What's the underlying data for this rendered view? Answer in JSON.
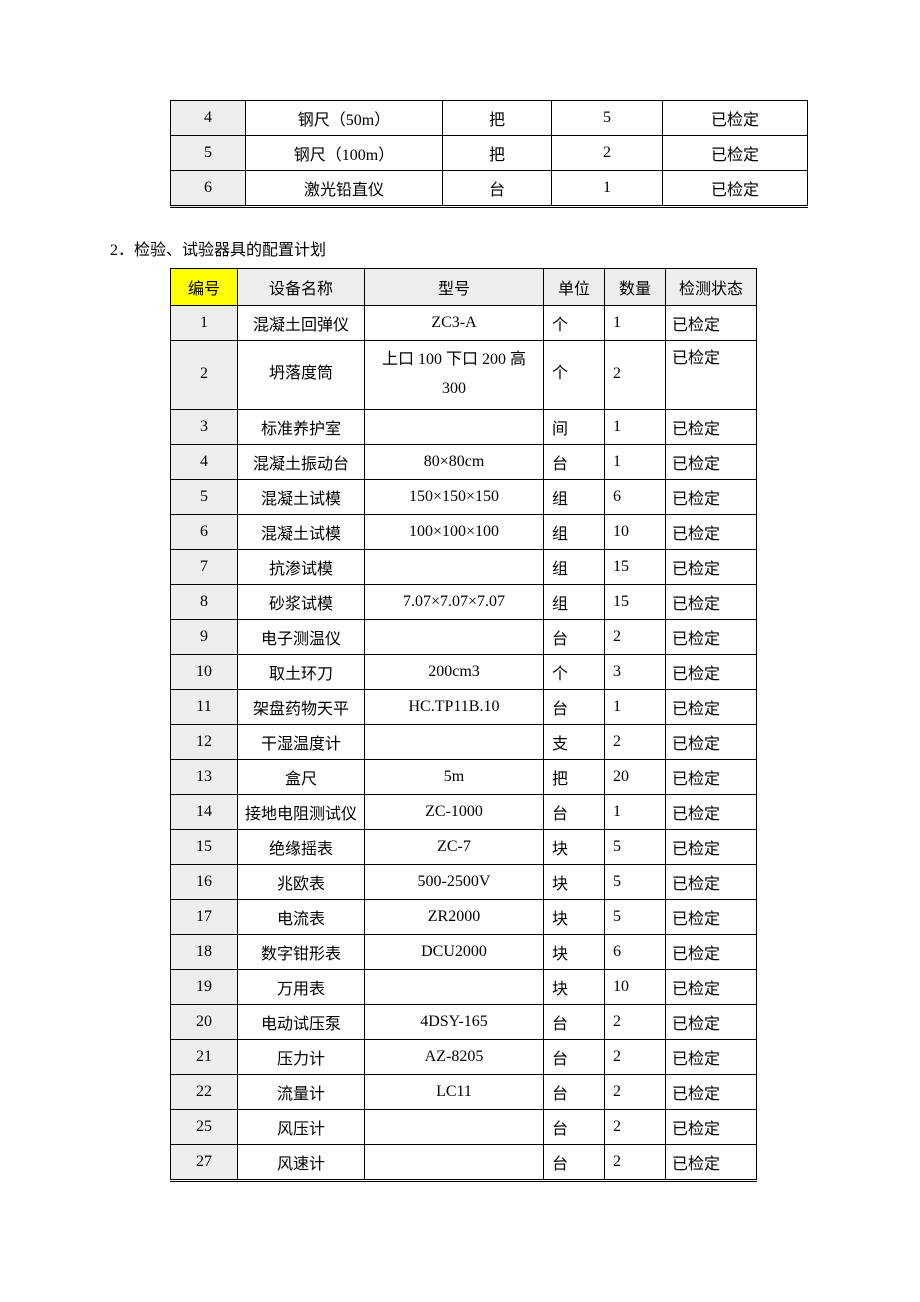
{
  "table1": {
    "rows": [
      {
        "num": "4",
        "name": "钢尺（50m）",
        "unit": "把",
        "qty": "5",
        "status": "已检定"
      },
      {
        "num": "5",
        "name": "钢尺（100m）",
        "unit": "把",
        "qty": "2",
        "status": "已检定"
      },
      {
        "num": "6",
        "name": "激光铅直仪",
        "unit": "台",
        "qty": "1",
        "status": "已检定"
      }
    ]
  },
  "section2_heading": "2．检验、试验器具的配置计划",
  "table2": {
    "headers": {
      "num": "编号",
      "name": "设备名称",
      "model": "型号",
      "unit": "单位",
      "qty": "数量",
      "status": "检测状态"
    },
    "rows": [
      {
        "num": "1",
        "name": "混凝土回弹仪",
        "model": "ZC3-A",
        "unit": "个",
        "qty": "1",
        "status": "已检定"
      },
      {
        "num": "2",
        "name": "坍落度筒",
        "model": "上口 100 下口 200 高300",
        "unit": "个",
        "qty": "2",
        "status": "已检定"
      },
      {
        "num": "3",
        "name": "标准养护室",
        "model": "",
        "unit": "间",
        "qty": "1",
        "status": "已检定"
      },
      {
        "num": "4",
        "name": "混凝土振动台",
        "model": "80×80cm",
        "unit": "台",
        "qty": "1",
        "status": "已检定"
      },
      {
        "num": "5",
        "name": "混凝土试模",
        "model": "150×150×150",
        "unit": "组",
        "qty": "6",
        "status": "已检定"
      },
      {
        "num": "6",
        "name": "混凝土试模",
        "model": "100×100×100",
        "unit": "组",
        "qty": "10",
        "status": "已检定"
      },
      {
        "num": "7",
        "name": "抗渗试模",
        "model": "",
        "unit": "组",
        "qty": "15",
        "status": "已检定"
      },
      {
        "num": "8",
        "name": "砂浆试模",
        "model": "7.07×7.07×7.07",
        "unit": "组",
        "qty": "15",
        "status": "已检定"
      },
      {
        "num": "9",
        "name": "电子测温仪",
        "model": "",
        "unit": "台",
        "qty": "2",
        "status": "已检定"
      },
      {
        "num": "10",
        "name": "取土环刀",
        "model": "200cm3",
        "unit": "个",
        "qty": "3",
        "status": "已检定"
      },
      {
        "num": "11",
        "name": "架盘药物天平",
        "model": "HC.TP11B.10",
        "unit": "台",
        "qty": "1",
        "status": "已检定"
      },
      {
        "num": "12",
        "name": "干湿温度计",
        "model": "",
        "unit": "支",
        "qty": "2",
        "status": "已检定"
      },
      {
        "num": "13",
        "name": "盒尺",
        "model": "5m",
        "unit": "把",
        "qty": "20",
        "status": "已检定"
      },
      {
        "num": "14",
        "name": "接地电阻测试仪",
        "model": "ZC-1000",
        "unit": "台",
        "qty": "1",
        "status": "已检定"
      },
      {
        "num": "15",
        "name": "绝缘摇表",
        "model": "ZC-7",
        "unit": "块",
        "qty": "5",
        "status": "已检定"
      },
      {
        "num": "16",
        "name": "兆欧表",
        "model": "500-2500V",
        "unit": "块",
        "qty": "5",
        "status": "已检定"
      },
      {
        "num": "17",
        "name": "电流表",
        "model": "ZR2000",
        "unit": "块",
        "qty": "5",
        "status": "已检定"
      },
      {
        "num": "18",
        "name": "数字钳形表",
        "model": "DCU2000",
        "unit": "块",
        "qty": "6",
        "status": "已检定"
      },
      {
        "num": "19",
        "name": "万用表",
        "model": "",
        "unit": "块",
        "qty": "10",
        "status": "已检定"
      },
      {
        "num": "20",
        "name": "电动试压泵",
        "model": "4DSY-165",
        "unit": "台",
        "qty": "2",
        "status": "已检定"
      },
      {
        "num": "21",
        "name": "压力计",
        "model": "AZ-8205",
        "unit": "台",
        "qty": "2",
        "status": "已检定"
      },
      {
        "num": "22",
        "name": "流量计",
        "model": "LC11",
        "unit": "台",
        "qty": "2",
        "status": "已检定"
      },
      {
        "num": "25",
        "name": "风压计",
        "model": "",
        "unit": "台",
        "qty": "2",
        "status": "已检定"
      },
      {
        "num": "27",
        "name": "风速计",
        "model": "",
        "unit": "台",
        "qty": "2",
        "status": "已检定"
      }
    ]
  }
}
